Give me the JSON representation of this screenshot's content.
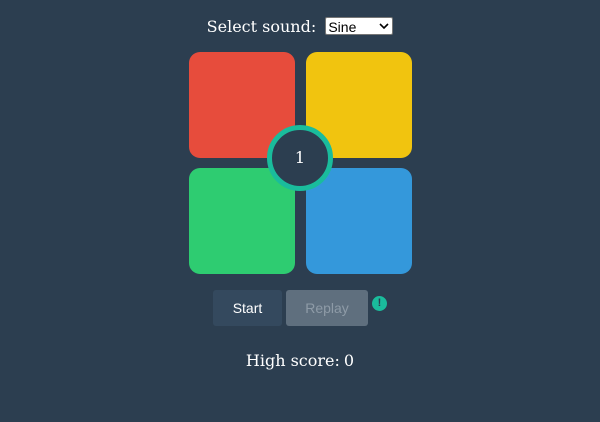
{
  "sound": {
    "label": "Select sound:",
    "selected": "Sine"
  },
  "pads": [
    {
      "name": "red",
      "color": "#e74c3c"
    },
    {
      "name": "yellow",
      "color": "#f1c40f"
    },
    {
      "name": "green",
      "color": "#2ecc71"
    },
    {
      "name": "blue",
      "color": "#3498db"
    }
  ],
  "counter": {
    "value": "1",
    "ring_color": "#1abc9c"
  },
  "controls": {
    "start_label": "Start",
    "replay_label": "Replay",
    "replay_enabled": false,
    "alert_glyph": "!",
    "alert_icon": "exclamation-circle-icon"
  },
  "score": {
    "label": "High score:",
    "value": "0"
  },
  "theme": {
    "background": "#2c3e50",
    "accent": "#1abc9c"
  }
}
